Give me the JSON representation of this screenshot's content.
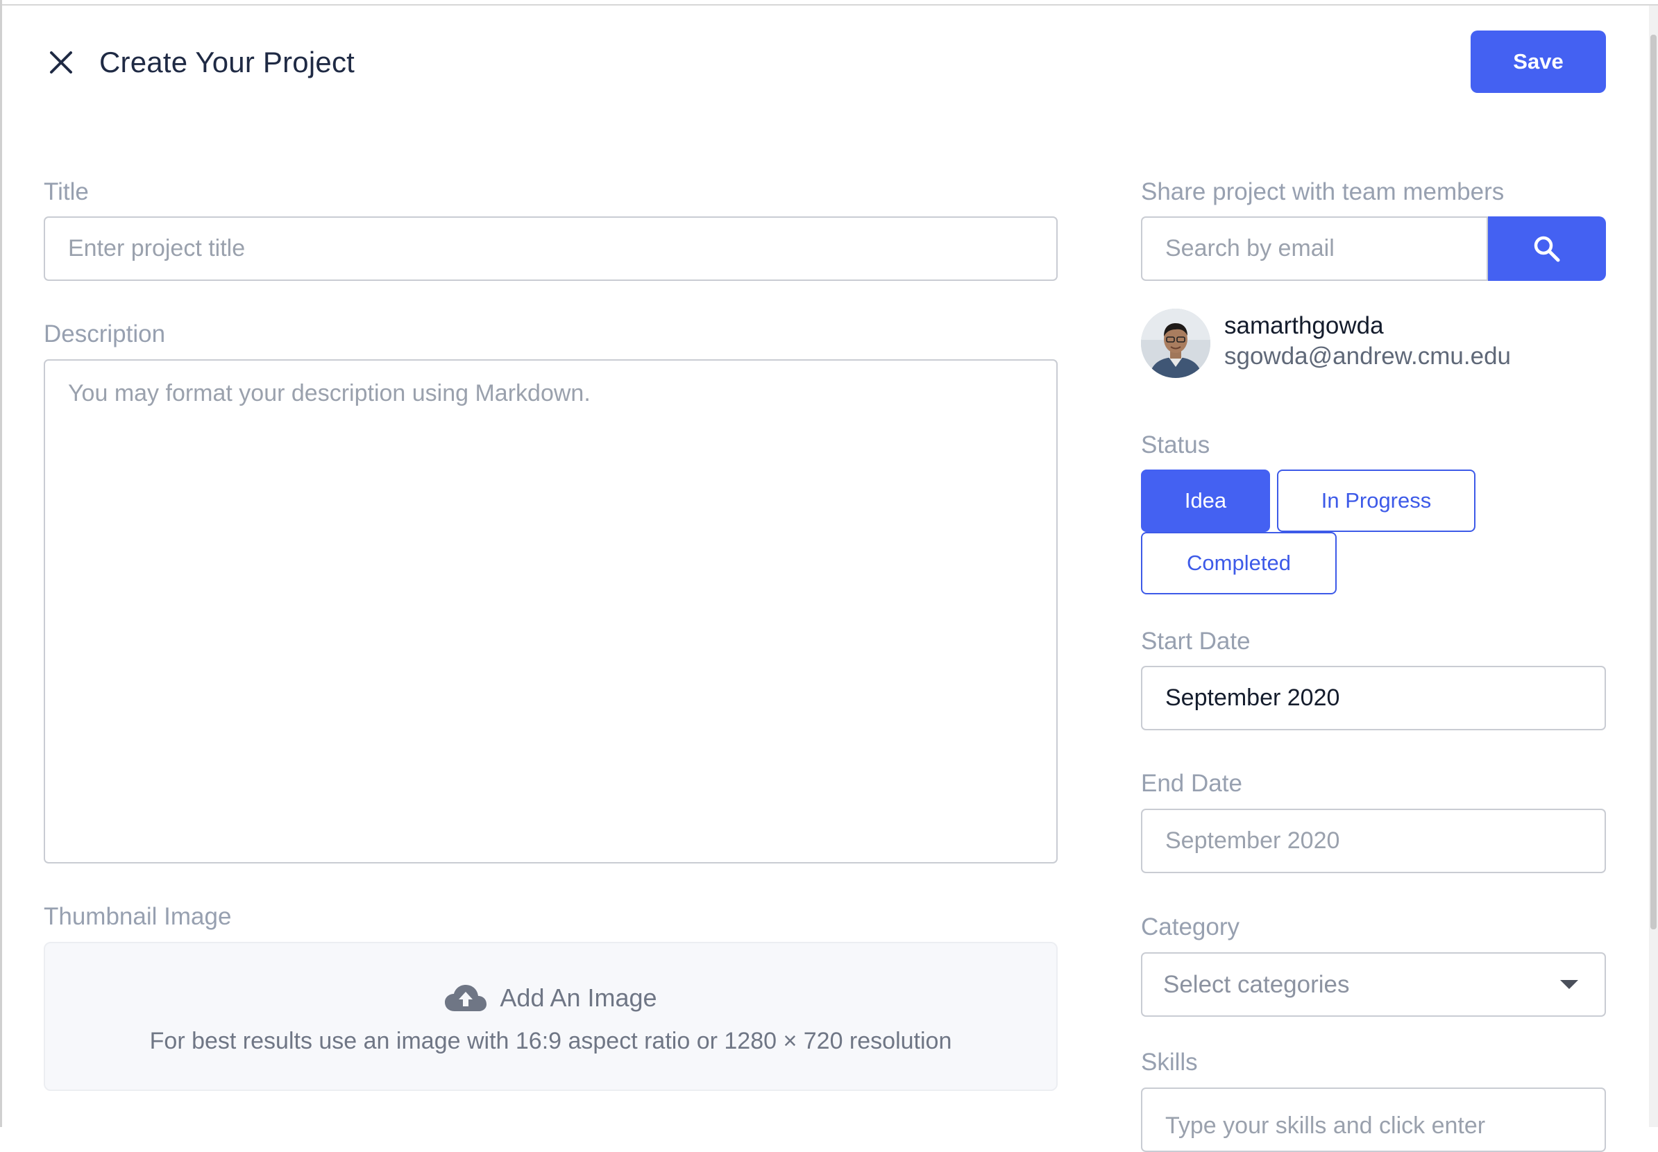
{
  "header": {
    "title": "Create Your Project",
    "save_label": "Save",
    "close_icon": "close-icon"
  },
  "form": {
    "title_label": "Title",
    "title_placeholder": "Enter project title",
    "description_label": "Description",
    "description_placeholder": "You may format your description using Markdown.",
    "thumbnail_label": "Thumbnail Image",
    "upload_title": "Add An Image",
    "upload_hint": "For best results use an image with 16:9 aspect ratio or 1280 × 720 resolution",
    "upload_icon": "cloud-upload-icon"
  },
  "sidebar": {
    "share_label": "Share project with team members",
    "search_placeholder": "Search by email",
    "search_icon": "search-icon",
    "member": {
      "name": "samarthgowda",
      "email": "sgowda@andrew.cmu.edu"
    },
    "status_label": "Status",
    "status_options": [
      {
        "label": "Idea",
        "selected": true
      },
      {
        "label": "In Progress",
        "selected": false
      },
      {
        "label": "Completed",
        "selected": false
      }
    ],
    "start_date_label": "Start Date",
    "start_date_value": "September 2020",
    "end_date_label": "End Date",
    "end_date_placeholder": "September 2020",
    "category_label": "Category",
    "category_placeholder": "Select categories",
    "skills_label": "Skills",
    "skills_placeholder": "Type your skills and click enter"
  },
  "colors": {
    "accent": "#4461f2",
    "label": "#97a0b0",
    "border": "#c9ccd3",
    "text": "#1f2a44"
  }
}
